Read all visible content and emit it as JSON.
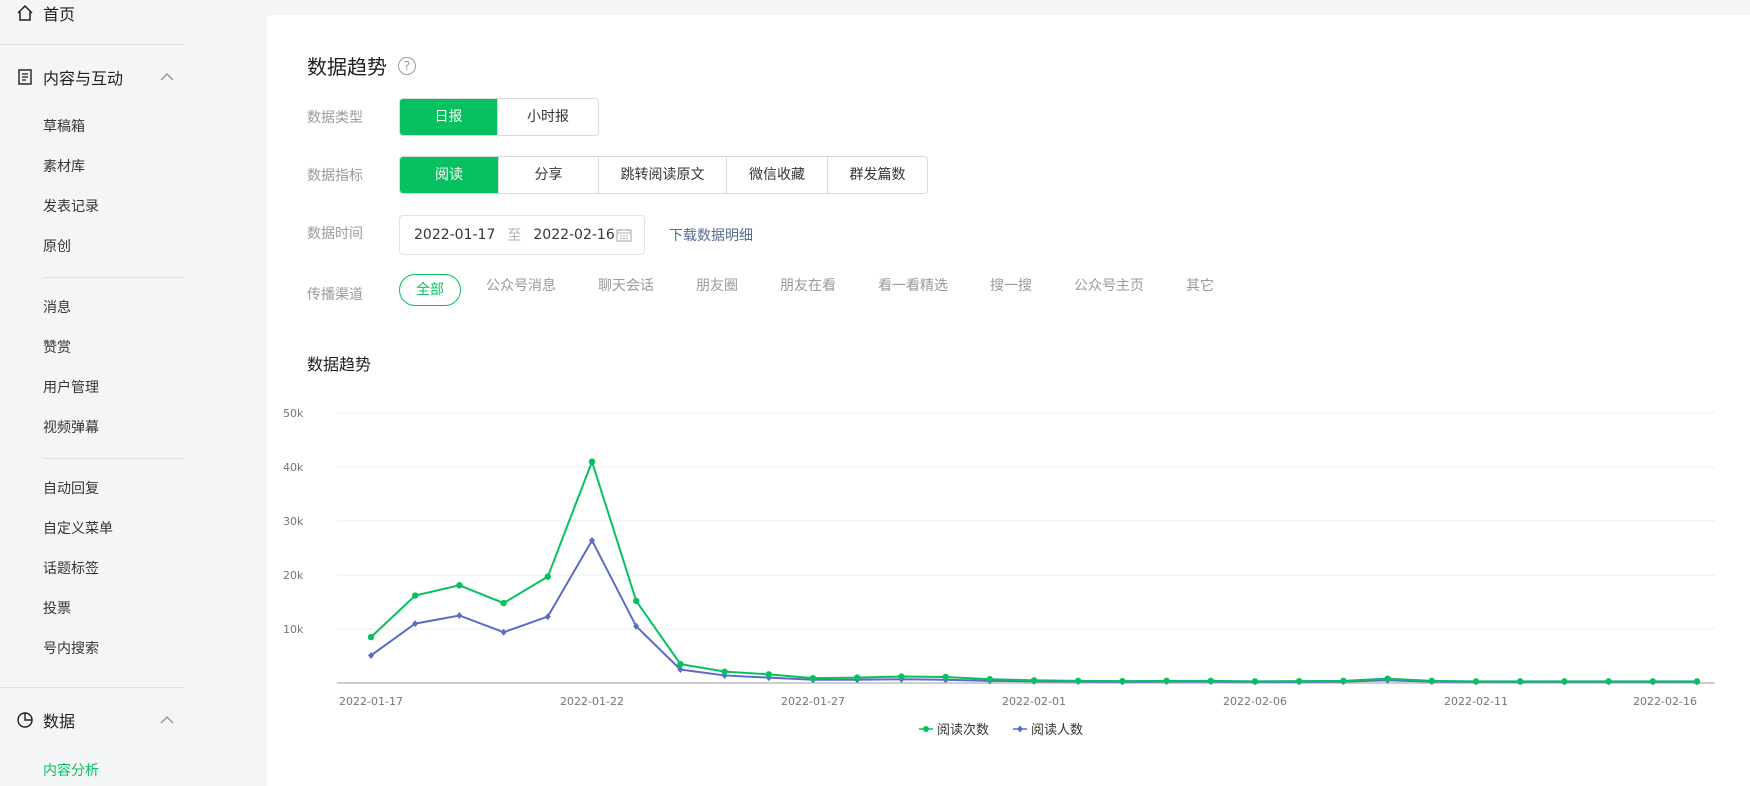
{
  "sidebar": {
    "home": "首页",
    "content_section": "内容与互动",
    "content_items": [
      "草稿箱",
      "素材库",
      "发表记录",
      "原创"
    ],
    "group2": [
      "消息",
      "赞赏",
      "用户管理",
      "视频弹幕"
    ],
    "group3": [
      "自动回复",
      "自定义菜单",
      "话题标签",
      "投票",
      "号内搜索"
    ],
    "data_section": "数据",
    "active_item": "内容分析"
  },
  "main": {
    "title": "数据趋势",
    "help": "?",
    "data_type": {
      "label": "数据类型",
      "options": [
        "日报",
        "小时报"
      ],
      "selected": "日报"
    },
    "metric": {
      "label": "数据指标",
      "options": [
        "阅读",
        "分享",
        "跳转阅读原文",
        "微信收藏",
        "群发篇数"
      ],
      "selected": "阅读"
    },
    "time": {
      "label": "数据时间",
      "start": "2022-01-17",
      "separator": "至",
      "end": "2022-02-16",
      "download": "下载数据明细"
    },
    "channel": {
      "label": "传播渠道",
      "options": [
        "全部",
        "公众号消息",
        "聊天会话",
        "朋友圈",
        "朋友在看",
        "看一看精选",
        "搜一搜",
        "公众号主页",
        "其它"
      ],
      "selected": "全部"
    },
    "chart_title": "数据趋势"
  },
  "colors": {
    "accent": "#07c160",
    "series2": "#5b6cc8",
    "link": "#576b95"
  },
  "chart_data": {
    "type": "line",
    "x": [
      "2022-01-17",
      "2022-01-18",
      "2022-01-19",
      "2022-01-20",
      "2022-01-21",
      "2022-01-22",
      "2022-01-23",
      "2022-01-24",
      "2022-01-25",
      "2022-01-26",
      "2022-01-27",
      "2022-01-28",
      "2022-01-29",
      "2022-01-30",
      "2022-01-31",
      "2022-02-01",
      "2022-02-02",
      "2022-02-03",
      "2022-02-04",
      "2022-02-05",
      "2022-02-06",
      "2022-02-07",
      "2022-02-08",
      "2022-02-09",
      "2022-02-10",
      "2022-02-11",
      "2022-02-12",
      "2022-02-13",
      "2022-02-14",
      "2022-02-15",
      "2022-02-16"
    ],
    "x_tick_labels": [
      "2022-01-17",
      "2022-01-22",
      "2022-01-27",
      "2022-02-01",
      "2022-02-06",
      "2022-02-11",
      "2022-02-16"
    ],
    "y_tick_labels": [
      "50k",
      "40k",
      "30k",
      "20k",
      "10k"
    ],
    "ylim": [
      0,
      50000
    ],
    "grid": true,
    "legend_position": "bottom",
    "series": [
      {
        "name": "阅读次数",
        "color": "#07c160",
        "values": [
          8500,
          16200,
          18100,
          14800,
          19700,
          41000,
          15200,
          3500,
          2100,
          1600,
          900,
          1000,
          1200,
          1100,
          700,
          500,
          400,
          350,
          400,
          400,
          300,
          350,
          400,
          800,
          400,
          300,
          300,
          300,
          300,
          300,
          300
        ]
      },
      {
        "name": "阅读人数",
        "color": "#5b6cc8",
        "values": [
          5100,
          11000,
          12500,
          9400,
          12300,
          26400,
          10500,
          2500,
          1400,
          1000,
          600,
          600,
          700,
          600,
          400,
          300,
          250,
          200,
          250,
          250,
          200,
          200,
          250,
          500,
          250,
          200,
          200,
          200,
          200,
          200,
          200
        ]
      }
    ]
  }
}
